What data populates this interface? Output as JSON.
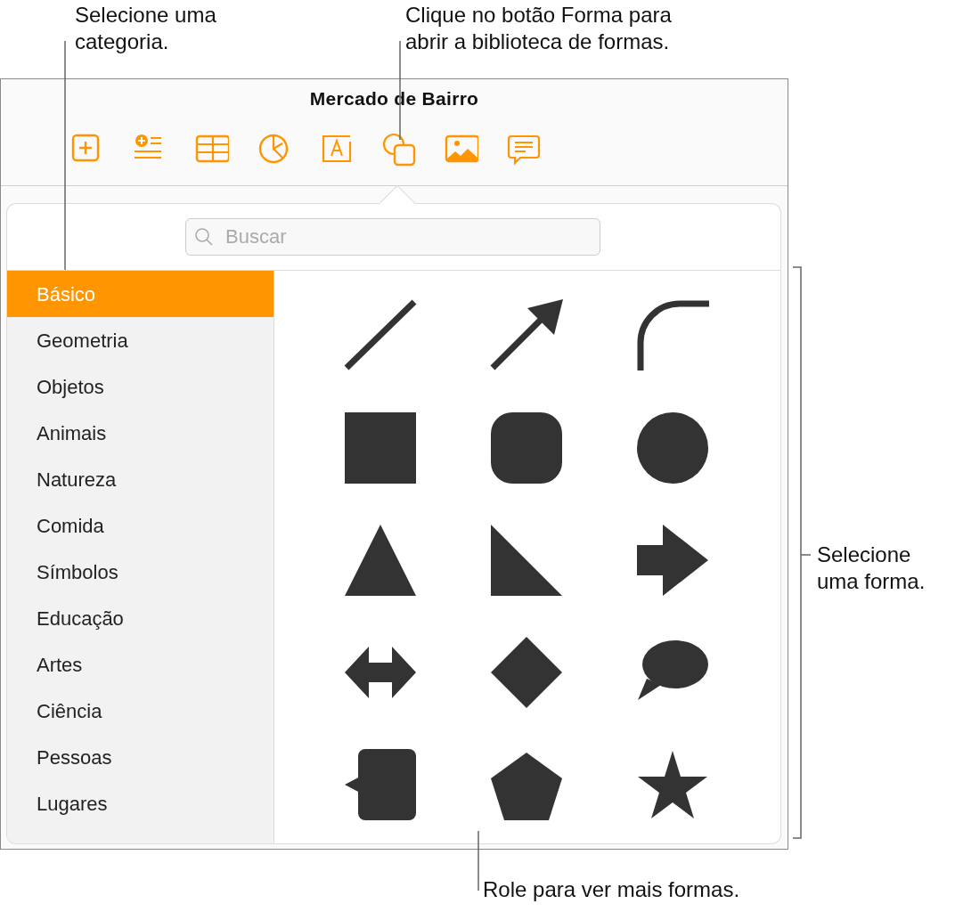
{
  "callouts": [
    {
      "kind": "category",
      "text": "Selecione uma\ncategoria."
    },
    {
      "kind": "button",
      "text": "Clique no botão Forma para\nabrir a biblioteca de formas."
    },
    {
      "kind": "shape",
      "text": "Selecione\numa forma."
    },
    {
      "kind": "scroll",
      "text": "Role para ver mais formas."
    }
  ],
  "window": {
    "title": "Mercado de Bairro"
  },
  "search": {
    "placeholder": "Buscar"
  },
  "categories": [
    {
      "label": "Básico",
      "selected": true
    },
    {
      "label": "Geometria",
      "selected": false
    },
    {
      "label": "Objetos",
      "selected": false
    },
    {
      "label": "Animais",
      "selected": false
    },
    {
      "label": "Natureza",
      "selected": false
    },
    {
      "label": "Comida",
      "selected": false
    },
    {
      "label": "Símbolos",
      "selected": false
    },
    {
      "label": "Educação",
      "selected": false
    },
    {
      "label": "Artes",
      "selected": false
    },
    {
      "label": "Ciência",
      "selected": false
    },
    {
      "label": "Pessoas",
      "selected": false
    },
    {
      "label": "Lugares",
      "selected": false
    }
  ],
  "shapes": [
    {
      "kind": "line"
    },
    {
      "kind": "arrow"
    },
    {
      "kind": "arc"
    },
    {
      "kind": "square"
    },
    {
      "kind": "rounded-square"
    },
    {
      "kind": "circle"
    },
    {
      "kind": "triangle"
    },
    {
      "kind": "right-triangle"
    },
    {
      "kind": "right-arrow"
    },
    {
      "kind": "double-arrow"
    },
    {
      "kind": "diamond"
    },
    {
      "kind": "speech-bubble"
    },
    {
      "kind": "callout"
    },
    {
      "kind": "pentagon"
    },
    {
      "kind": "star"
    }
  ]
}
